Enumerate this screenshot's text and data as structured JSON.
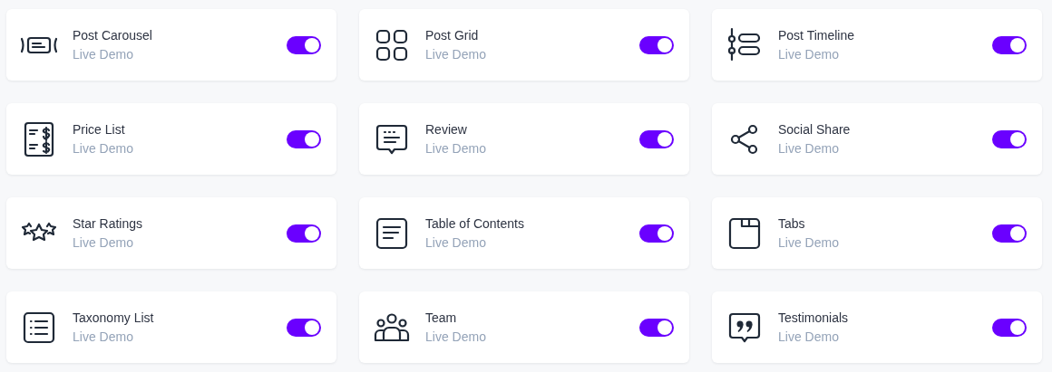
{
  "widgets": [
    {
      "title": "Post Carousel",
      "link": "Live Demo",
      "on": true
    },
    {
      "title": "Post Grid",
      "link": "Live Demo",
      "on": true
    },
    {
      "title": "Post Timeline",
      "link": "Live Demo",
      "on": true
    },
    {
      "title": "Price List",
      "link": "Live Demo",
      "on": true
    },
    {
      "title": "Review",
      "link": "Live Demo",
      "on": true
    },
    {
      "title": "Social Share",
      "link": "Live Demo",
      "on": true
    },
    {
      "title": "Star Ratings",
      "link": "Live Demo",
      "on": true
    },
    {
      "title": "Table of Contents",
      "link": "Live Demo",
      "on": true
    },
    {
      "title": "Tabs",
      "link": "Live Demo",
      "on": true
    },
    {
      "title": "Taxonomy List",
      "link": "Live Demo",
      "on": true
    },
    {
      "title": "Team",
      "link": "Live Demo",
      "on": true
    },
    {
      "title": "Testimonials",
      "link": "Live Demo",
      "on": true
    }
  ]
}
